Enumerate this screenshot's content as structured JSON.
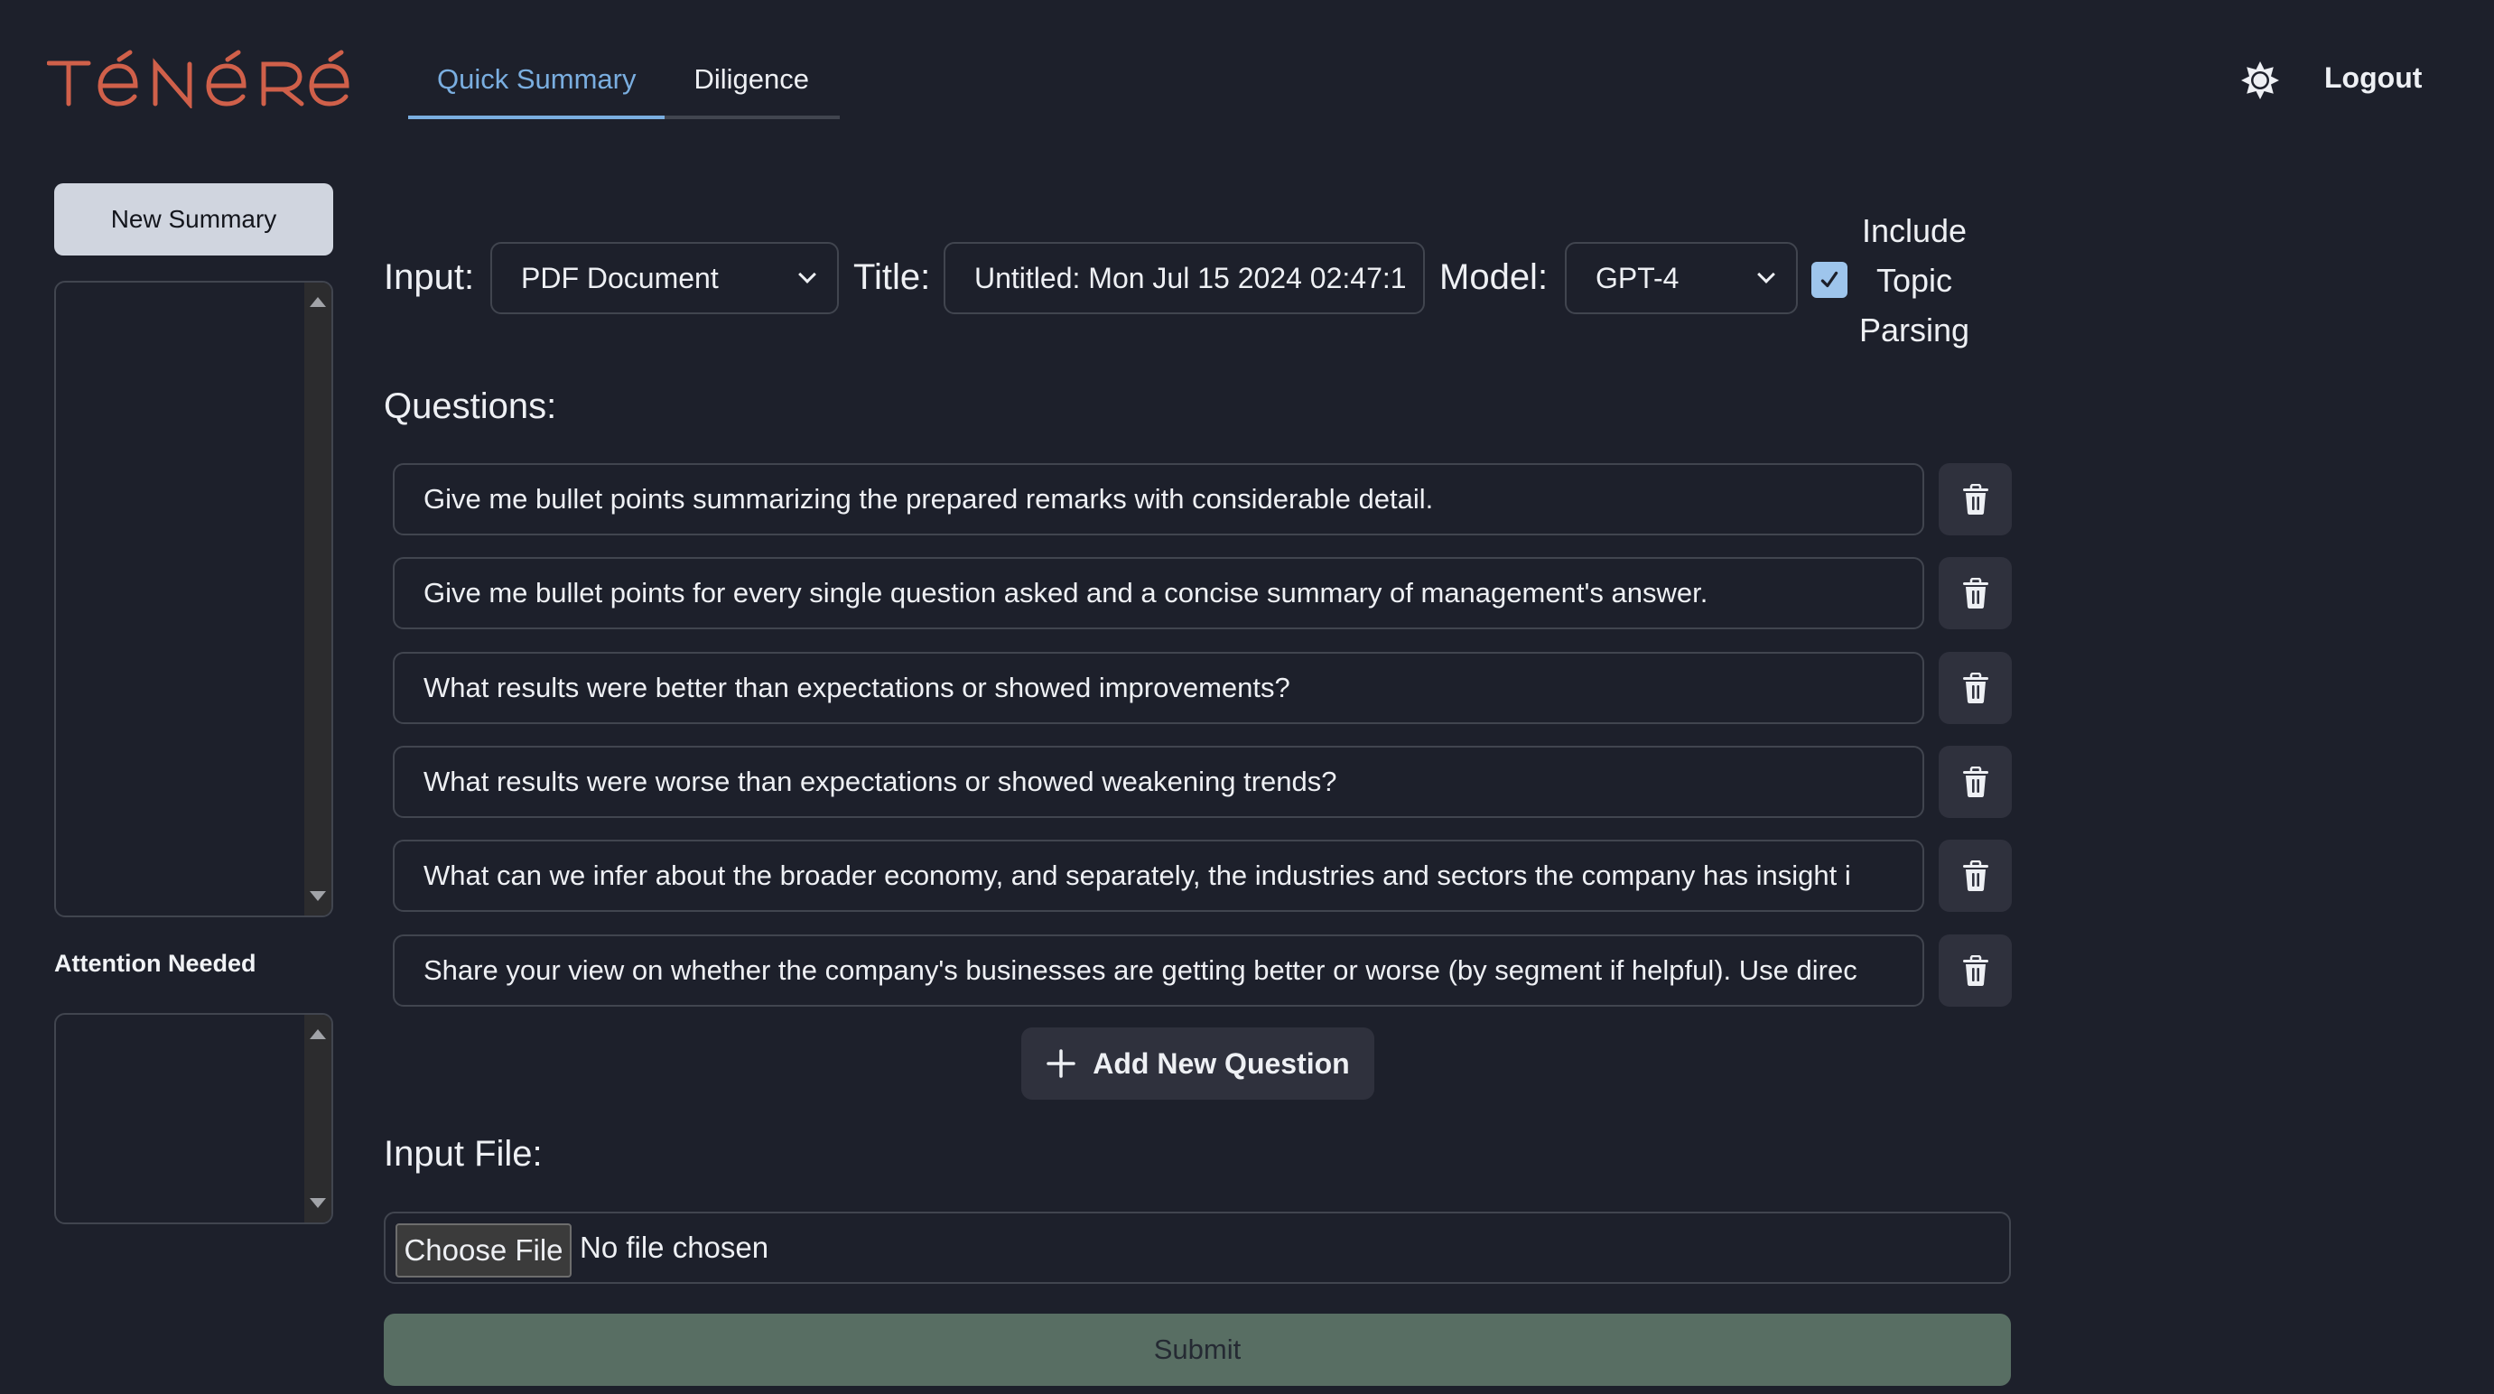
{
  "app": {
    "brand": "TÉNÉRÉ",
    "brand_color": "#d0604a",
    "accent_color": "#7aaee0"
  },
  "header": {
    "tabs": [
      {
        "label": "Quick Summary",
        "active": true
      },
      {
        "label": "Diligence",
        "active": false
      }
    ],
    "theme_icon": "sun-icon",
    "logout_label": "Logout"
  },
  "sidebar": {
    "new_summary_label": "New Summary",
    "summaries": [],
    "attention_label": "Attention Needed",
    "attention_items": []
  },
  "form": {
    "input_label": "Input:",
    "input_value": "PDF Document",
    "title_label": "Title:",
    "title_value": "Untitled: Mon Jul 15 2024 02:47:1",
    "model_label": "Model:",
    "model_value": "GPT-4",
    "topic_parsing": {
      "checked": true,
      "label_lines": [
        "Include",
        "Topic",
        "Parsing"
      ]
    },
    "questions_label": "Questions:",
    "questions": [
      "Give me bullet points summarizing the prepared remarks with considerable detail.",
      "Give me bullet points for every single question asked and a concise summary of management's answer.",
      "What results were better than expectations or showed improvements?",
      "What results were worse than expectations or showed weakening trends?",
      "What can we infer about the broader economy, and separately, the industries and sectors the company has insight i",
      "Share your view on whether the company's businesses are getting better or worse (by segment if helpful). Use direc"
    ],
    "add_question_label": "Add New Question",
    "input_file_label": "Input File:",
    "choose_file_label": "Choose File",
    "no_file_label": "No file chosen",
    "submit_label": "Submit"
  }
}
